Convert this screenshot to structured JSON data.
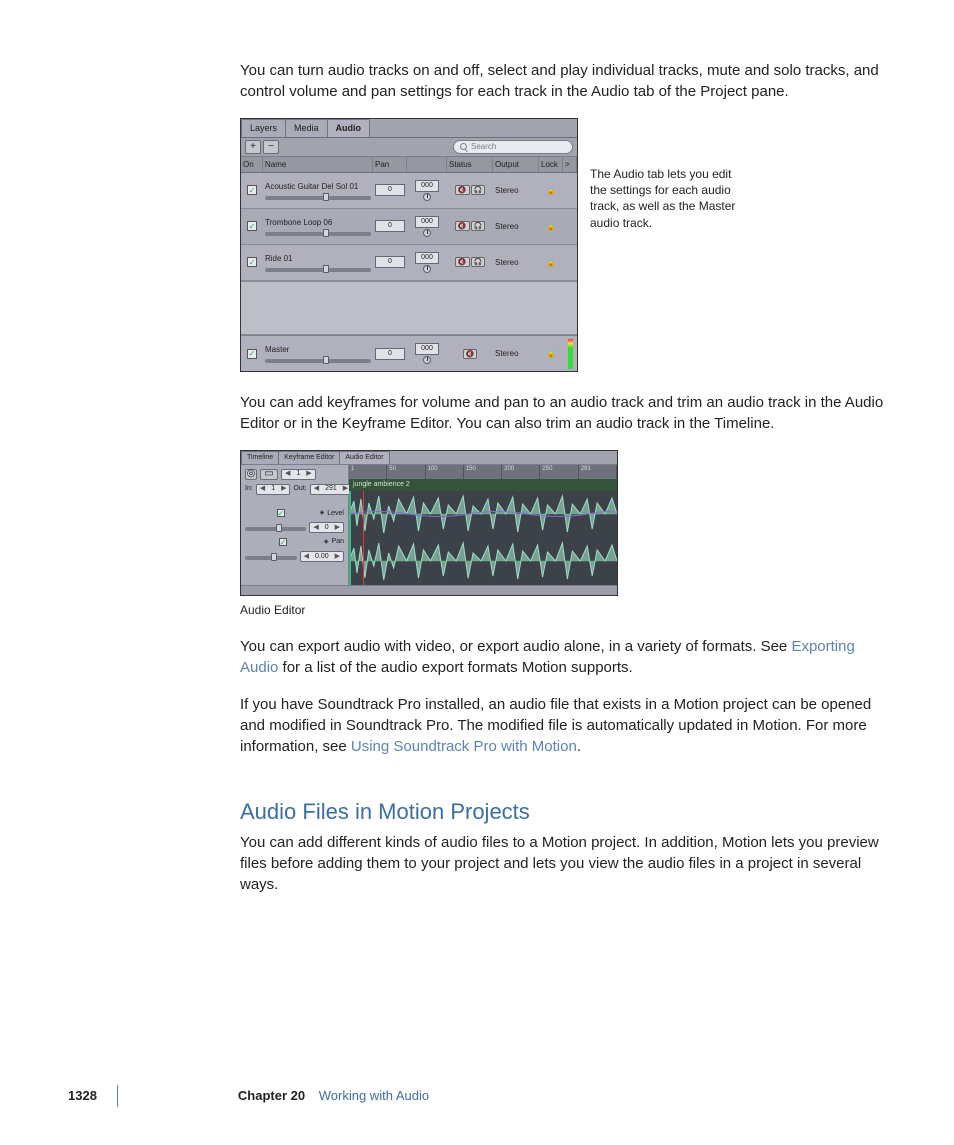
{
  "paragraphs": {
    "p1": "You can turn audio tracks on and off, select and play individual tracks, mute and solo tracks, and control volume and pan settings for each track in the Audio tab of the Project pane.",
    "p2": "You can add keyframes for volume and pan to an audio track and trim an audio track in the Audio Editor or in the Keyframe Editor. You can also trim an audio track in the Timeline.",
    "p3a": "You can export audio with video, or export audio alone, in a variety of formats. See ",
    "p3_link": "Exporting Audio",
    "p3b": " for a list of the audio export formats Motion supports.",
    "p4a": "If you have Soundtrack Pro installed, an audio file that exists in a Motion project can be opened and modified in Soundtrack Pro. The modified file is automatically updated in Motion. For more information, see ",
    "p4_link": "Using Soundtrack Pro with Motion",
    "p4b": ".",
    "heading": "Audio Files in Motion Projects",
    "p5": "You can add different kinds of audio files to a Motion project. In addition, Motion lets you preview files before adding them to your project and lets you view the audio files in a project in several ways."
  },
  "callout": "The Audio tab lets you edit the settings for each audio track, as well as the Master audio track.",
  "caption_audio_editor": "Audio Editor",
  "audio_panel": {
    "tabs": [
      "Layers",
      "Media",
      "Audio"
    ],
    "buttons": {
      "add": "+",
      "remove": "−"
    },
    "search_placeholder": "Search",
    "columns": [
      "On",
      "Name",
      "Pan",
      "",
      "Status",
      "Output",
      "Lock",
      ">"
    ],
    "tracks": [
      {
        "name": "Acoustic Guitar Del Sol 01",
        "level": "0",
        "pan": "000",
        "output": "Stereo"
      },
      {
        "name": "Trombone Loop 06",
        "level": "0",
        "pan": "000",
        "output": "Stereo"
      },
      {
        "name": "Ride 01",
        "level": "0",
        "pan": "000",
        "output": "Stereo"
      }
    ],
    "master": {
      "name": "Master",
      "level": "0",
      "pan": "000",
      "output": "Stereo"
    }
  },
  "audio_editor": {
    "tabs": [
      "Timeline",
      "Keyframe Editor",
      "Audio Editor"
    ],
    "in_label": "In:",
    "in_value": "1",
    "out_label": "Out:",
    "out_value": "291",
    "level_label": "Level",
    "level_value": "0",
    "pan_label": "Pan",
    "pan_value": "0.00",
    "track_name": "jungle ambience 2",
    "ruler": [
      "1",
      "50",
      "100",
      "150",
      "200",
      "250",
      "291"
    ]
  },
  "footer": {
    "page": "1328",
    "chapter_num": "Chapter 20",
    "chapter_title": "Working with Audio"
  }
}
